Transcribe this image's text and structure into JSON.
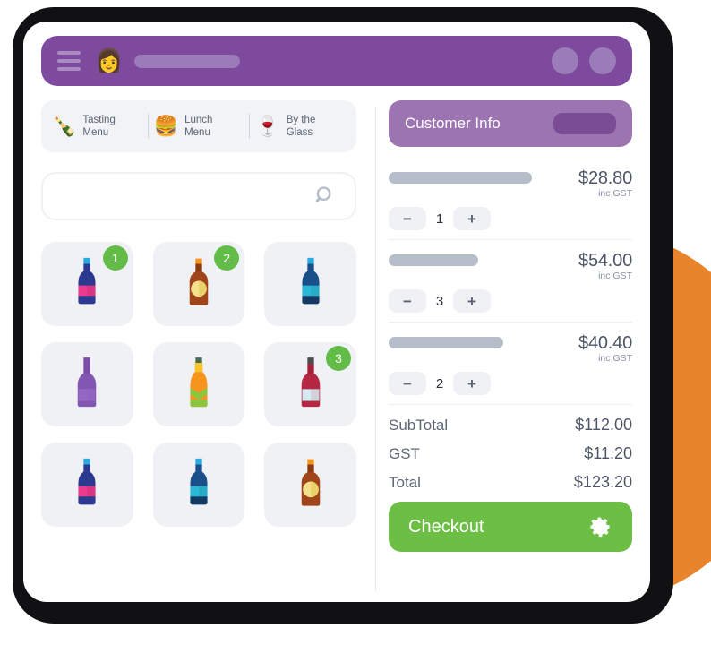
{
  "theme": {
    "header_purple": "#7D4A9E",
    "customer_purple": "#9C74B2",
    "accent_green": "#6CBE45",
    "badge_green": "#62BC47",
    "orange_circle": "#E8842B",
    "tile_gray": "#EFF1F5",
    "text_dark": "#4E5767"
  },
  "topbar": {
    "menu_icon": "hamburger-icon",
    "avatar_icon": "👩",
    "avatar_name": "user-avatar",
    "placeholder_pill": "",
    "right_button_1": "circle-button",
    "right_button_2": "circle-button"
  },
  "menu_tabs": [
    {
      "icon": "🍾",
      "icon_name": "tasting-menu-icon",
      "label": "Tasting\nMenu",
      "line1": "Tasting",
      "line2": "Menu"
    },
    {
      "icon": "🍔",
      "icon_name": "lunch-menu-icon",
      "label": "Lunch\nMenu",
      "line1": "Lunch",
      "line2": "Menu"
    },
    {
      "icon": "🍷",
      "icon_name": "by-the-glass-icon",
      "label": "By the\nGlass",
      "line1": "By the",
      "line2": "Glass"
    }
  ],
  "search": {
    "value": "",
    "placeholder": "",
    "icon": "search-icon"
  },
  "products": [
    {
      "id": 1,
      "icon_name": "bottle-blue-pink",
      "badge": "1",
      "colors": {
        "cap": "#29ABE2",
        "neck": "#2B3990",
        "body": "#2B3990",
        "label": "#EC3B8B",
        "base": "#2B3990"
      },
      "shape": "bottle"
    },
    {
      "id": 2,
      "icon_name": "bottle-brown-beer",
      "badge": "2",
      "colors": {
        "cap": "#F7941E",
        "neck": "#8C3A12",
        "body": "#A0441A",
        "label": "#F5E08C",
        "base": "#8C3A12"
      },
      "shape": "beer"
    },
    {
      "id": 3,
      "icon_name": "bottle-blue-striped",
      "badge": "",
      "colors": {
        "cap": "#29ABE2",
        "neck": "#1B4F8A",
        "body": "#1B4F8A",
        "label": "#2BB8D6",
        "base": "#123A63"
      },
      "shape": "bottle"
    },
    {
      "id": 4,
      "icon_name": "bottle-purple",
      "badge": "",
      "colors": {
        "cap": "#7B4BA8",
        "neck": "#7B4BA8",
        "body": "#8456B4",
        "label": "#9468C4",
        "base": "#6E3F9B"
      },
      "shape": "wine"
    },
    {
      "id": 5,
      "icon_name": "bottle-green-orange",
      "badge": "",
      "colors": {
        "cap": "#4A6B52",
        "neck": "#F7C52B",
        "body": "#F7941E",
        "label": "#8CC63F",
        "base": "#8CC63F"
      },
      "shape": "tall"
    },
    {
      "id": 6,
      "icon_name": "bottle-red-wine",
      "badge": "3",
      "colors": {
        "cap": "#4D4D4D",
        "neck": "#A32038",
        "body": "#B52642",
        "label": "#D6EAF2",
        "base": "#A32038"
      },
      "shape": "wine"
    },
    {
      "id": 7,
      "icon_name": "bottle-blue-pink-2",
      "badge": "",
      "colors": {
        "cap": "#29ABE2",
        "neck": "#2B3990",
        "body": "#2B3990",
        "label": "#EC3B8B",
        "base": "#2B3990"
      },
      "shape": "bottle"
    },
    {
      "id": 8,
      "icon_name": "bottle-blue-striped-2",
      "badge": "",
      "colors": {
        "cap": "#29ABE2",
        "neck": "#1B4F8A",
        "body": "#1B4F8A",
        "label": "#2BB8D6",
        "base": "#123A63"
      },
      "shape": "bottle"
    },
    {
      "id": 9,
      "icon_name": "bottle-brown-beer-2",
      "badge": "",
      "colors": {
        "cap": "#F7941E",
        "neck": "#8C3A12",
        "body": "#A0441A",
        "label": "#F5E08C",
        "base": "#8C3A12"
      },
      "shape": "beer"
    }
  ],
  "customer": {
    "title": "Customer Info",
    "action_pill": ""
  },
  "cart": {
    "items": [
      {
        "name_placeholder_width": 160,
        "price": "$28.80",
        "tax_note": "inc GST",
        "qty": "1",
        "minus": "−",
        "plus": "+"
      },
      {
        "name_placeholder_width": 100,
        "price": "$54.00",
        "tax_note": "inc GST",
        "qty": "3",
        "minus": "−",
        "plus": "+"
      },
      {
        "name_placeholder_width": 128,
        "price": "$40.40",
        "tax_note": "inc GST",
        "qty": "2",
        "minus": "−",
        "plus": "+"
      }
    ]
  },
  "totals": [
    {
      "label": "SubTotal",
      "value": "$112.00"
    },
    {
      "label": "GST",
      "value": "$11.20"
    },
    {
      "label": "Total",
      "value": "$123.20"
    }
  ],
  "checkout": {
    "label": "Checkout",
    "icon": "gear-icon"
  }
}
